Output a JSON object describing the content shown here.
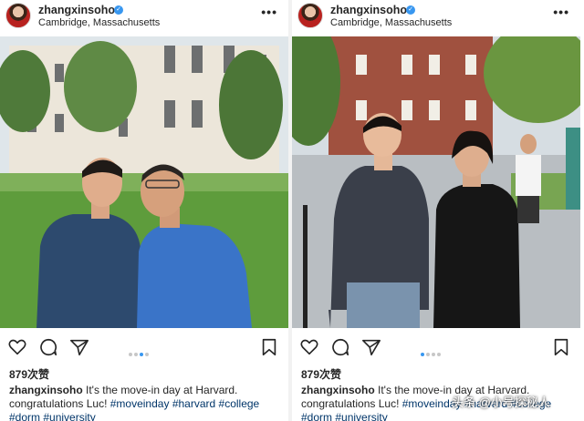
{
  "posts": [
    {
      "username": "zhangxinsoho",
      "location": "Cambridge, Massachusetts",
      "more": "•••",
      "likes": "879次赞",
      "caption": {
        "user": "zhangxinsoho",
        "text": " It's the move-in day at Harvard. congratulations Luc! ",
        "tags": [
          "#moveinday",
          "#harvard",
          "#college",
          "#dorm",
          "#university"
        ]
      },
      "carousel": {
        "count": 4,
        "active": 2
      },
      "icons": [
        "heart-icon",
        "comment-icon",
        "share-icon",
        "bookmark-icon"
      ]
    },
    {
      "username": "zhangxinsoho",
      "location": "Cambridge, Massachusetts",
      "more": "•••",
      "likes": "879次赞",
      "caption": {
        "user": "zhangxinsoho",
        "text": " It's the move-in day at Harvard. congratulations Luc! ",
        "tags": [
          "#moveinday",
          "#harvard",
          "#college",
          "#dorm",
          "#university"
        ]
      },
      "carousel": {
        "count": 4,
        "active": 0
      },
      "icons": [
        "heart-icon",
        "comment-icon",
        "share-icon",
        "bookmark-icon"
      ]
    }
  ],
  "watermark": "头条 @小号探秘人",
  "colors": {
    "link": "#003569",
    "dot_active": "#3897f0",
    "verified": "#3897f0"
  }
}
